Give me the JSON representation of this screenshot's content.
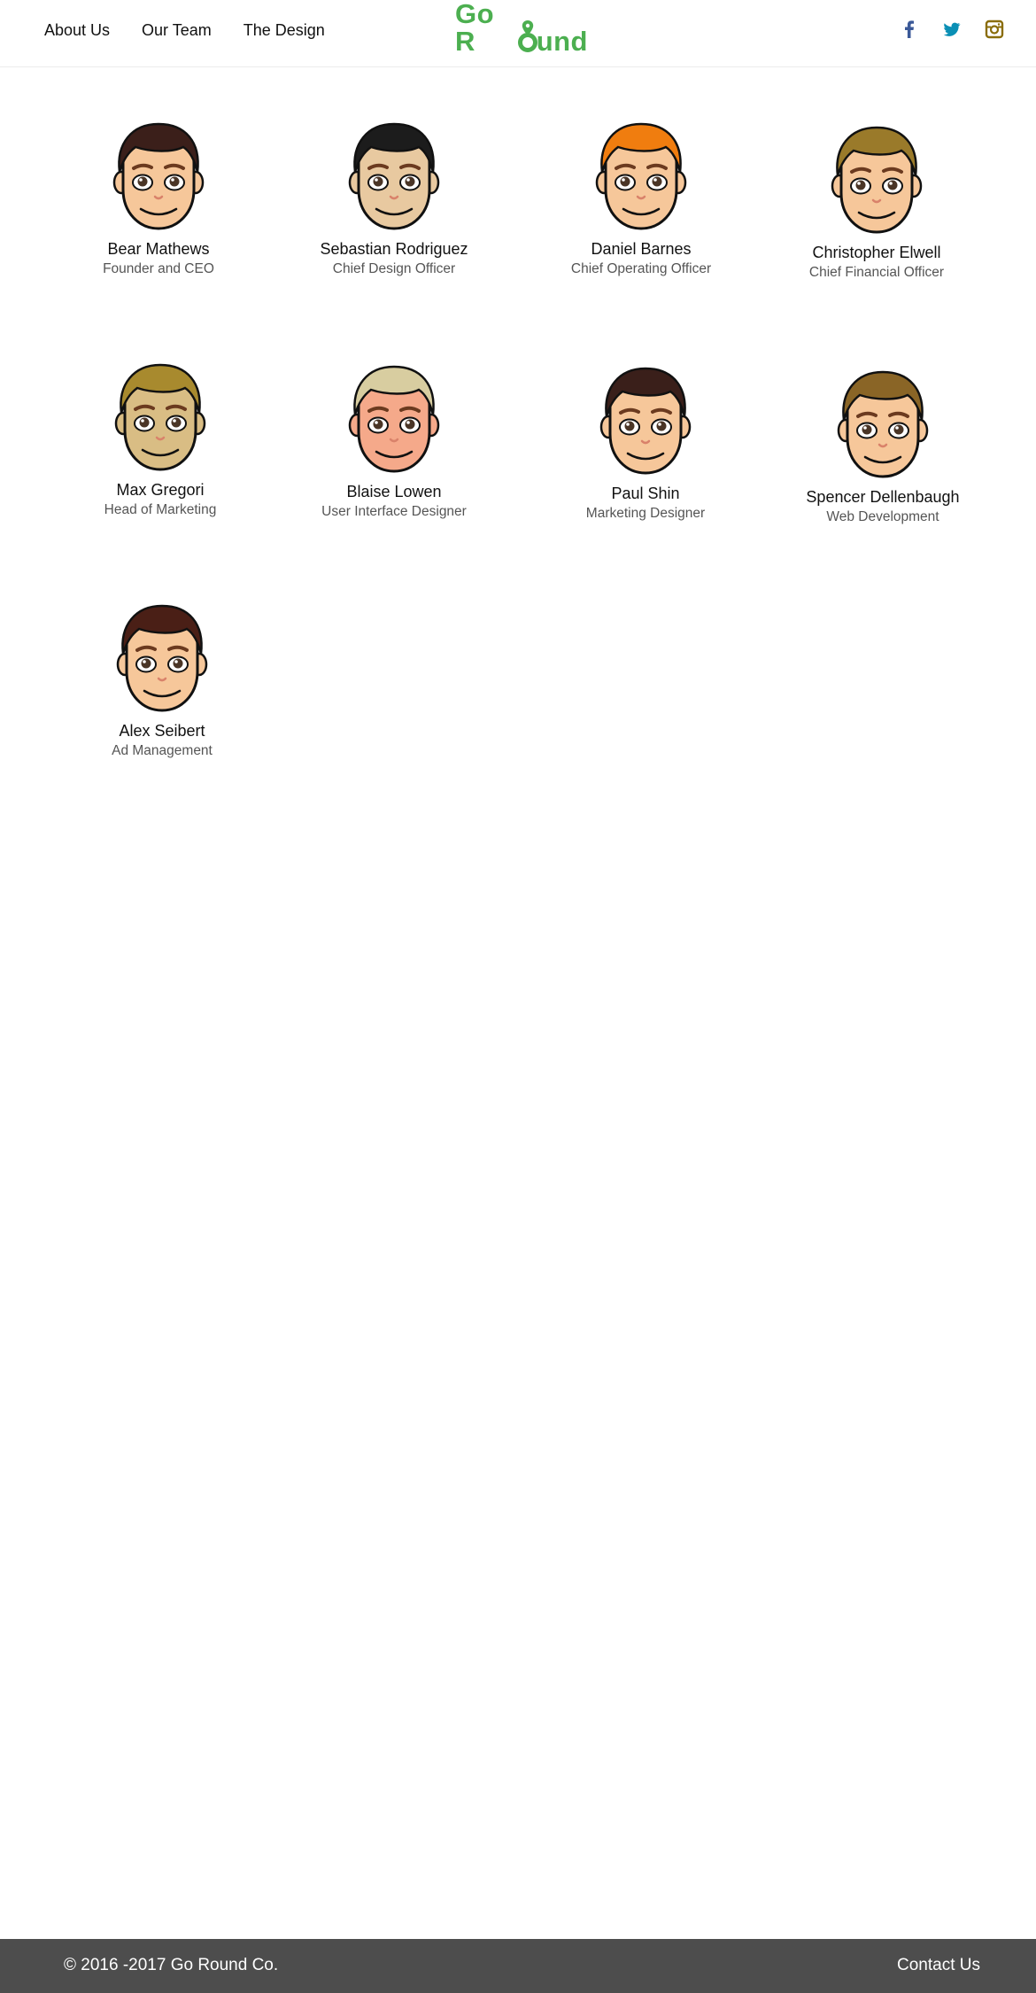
{
  "nav": {
    "items": [
      {
        "label": "About Us"
      },
      {
        "label": "Our Team"
      },
      {
        "label": "The Design"
      }
    ]
  },
  "logo": {
    "part1": "Go R",
    "part2": "und",
    "color": "#4caf50"
  },
  "social": {
    "icons": [
      "facebook-icon",
      "twitter-icon",
      "instagram-icon"
    ],
    "colors": {
      "facebook": "#3b5998",
      "twitter": "#0a8fb5",
      "instagram": "#8a6d0b"
    }
  },
  "team": [
    {
      "name": "Bear Mathews",
      "role": "Founder and CEO",
      "hair": "#3b1f1a",
      "skin": "#f6c79a"
    },
    {
      "name": "Sebastian Rodriguez",
      "role": "Chief Design Officer",
      "hair": "#1c1c1c",
      "skin": "#e8c9a0"
    },
    {
      "name": "Daniel Barnes",
      "role": "Chief Operating Officer",
      "hair": "#f07d0f",
      "skin": "#f6c79a"
    },
    {
      "name": "Christopher Elwell",
      "role": "Chief Financial Officer",
      "hair": "#9a7a2a",
      "skin": "#f6c79a"
    },
    {
      "name": "Max Gregori",
      "role": "Head of Marketing",
      "hair": "#a88a2e",
      "skin": "#d9bd84"
    },
    {
      "name": "Blaise Lowen",
      "role": "User Interface Designer",
      "hair": "#d8cda0",
      "skin": "#f5a98a"
    },
    {
      "name": "Paul Shin",
      "role": "Marketing Designer",
      "hair": "#3a1f1a",
      "skin": "#f6c79a"
    },
    {
      "name": "Spencer Dellenbaugh",
      "role": "Web Development",
      "hair": "#8a6526",
      "skin": "#f6c79a"
    },
    {
      "name": "Alex Seibert",
      "role": "Ad Management",
      "hair": "#4a1f16",
      "skin": "#f6c79a"
    }
  ],
  "footer": {
    "copyright": "© 2016 -2017 Go Round Co.",
    "contact": "Contact Us",
    "background": "#4d4d4d"
  }
}
